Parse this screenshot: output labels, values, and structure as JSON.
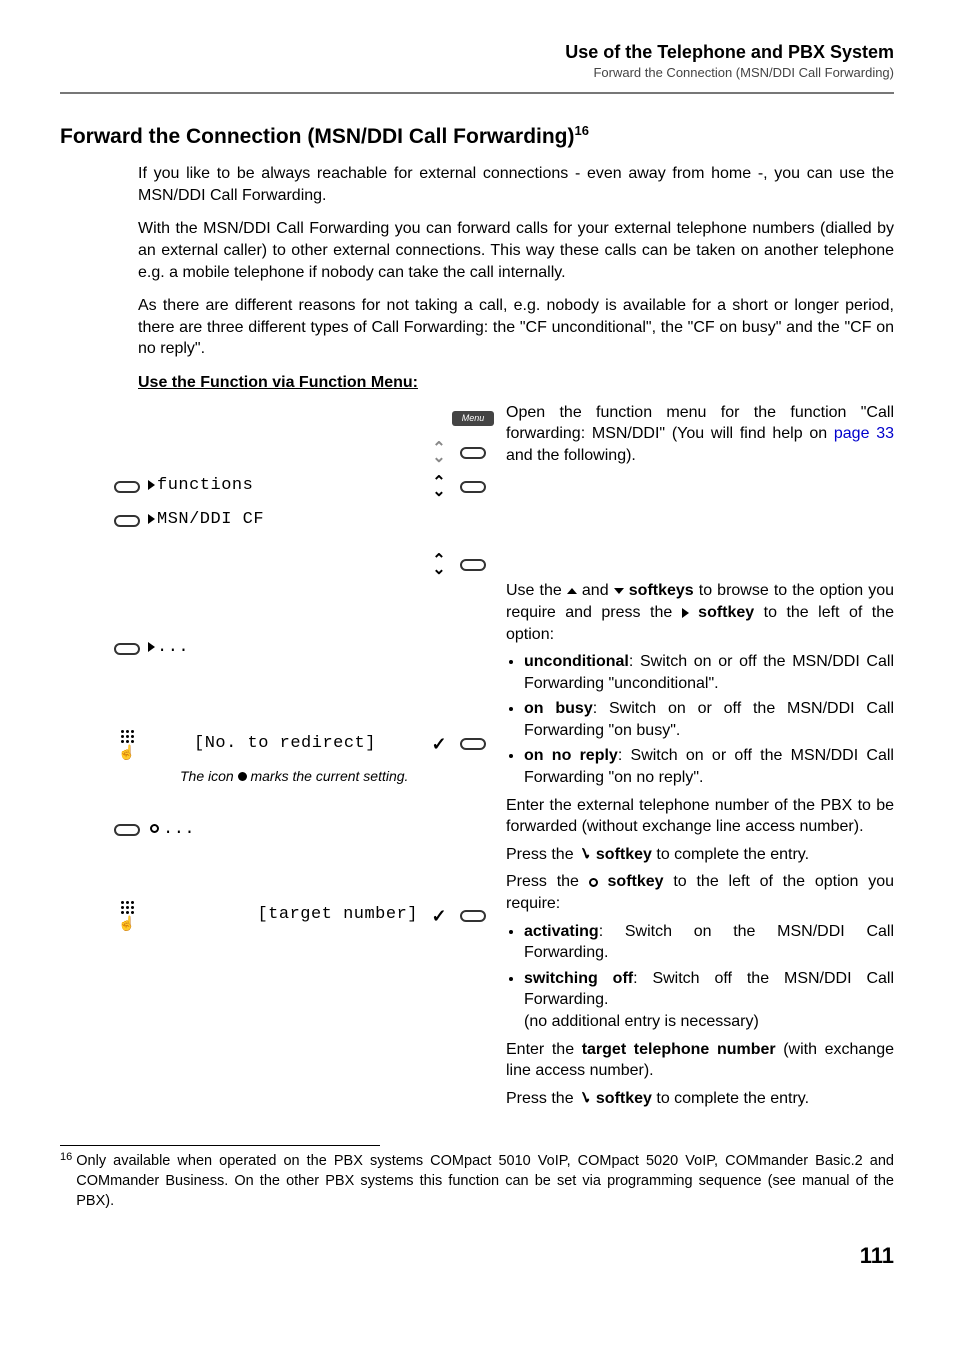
{
  "header": {
    "title": "Use of the Telephone and PBX System",
    "subtitle": "Forward the Connection (MSN/DDI Call Forwarding)"
  },
  "section": {
    "title": "Forward the Connection (MSN/DDI Call Forwarding)",
    "footnote_ref": "16",
    "para1": "If you like to be always reachable for external connections - even away from home -, you can use the MSN/DDI Call Forwarding.",
    "para2": "With the MSN/DDI Call Forwarding you can forward calls for your external telephone numbers (dialled by an external caller) to other external connections. This way these calls can be taken on another telephone e.g. a mobile telephone if nobody can take the call internally.",
    "para3": "As there are different reasons for not taking a call, e.g. nobody is available for a short or longer period, there are three different types of Call Forwarding: the \"CF unconditional\", the \"CF on busy\" and the \"CF on no reply\".",
    "subheading": "Use the Function via Function Menu:"
  },
  "left": {
    "menu_badge": "Menu",
    "row_functions": "functions",
    "row_msnddi": "MSN/DDI CF",
    "row_dots": "...",
    "row_no_redirect": "[No. to redirect]",
    "row_circle_dots": "...",
    "row_target": "[target number]",
    "note_pre": "The icon ",
    "note_post": " marks the current setting."
  },
  "right": {
    "open_p1": "Open the function menu for the function \"Call forwarding: MSN/DDI\" (You will find help on ",
    "open_link": "page 33",
    "open_p2": " and the following).",
    "browse_p1": "Use the ",
    "browse_p2": " and ",
    "browse_p3_pre": " ",
    "softkeys": "softkeys",
    "browse_p3": " to browse to the option you require and press the ",
    "softkey": "softkey",
    "browse_p4": " to the left of the option:",
    "li_uncond_b": "unconditional",
    "li_uncond_t": ": Switch on or off the MSN/DDI Call Forwarding \"unconditional\".",
    "li_busy_b": "on busy",
    "li_busy_t": ": Switch on or off the MSN/DDI Call Forwarding \"on busy\".",
    "li_noreply_b": "on no reply",
    "li_noreply_t": ": Switch on or off the MSN/DDI Call Forwarding \"on no reply\".",
    "enter_ext": "Enter the external telephone number of the PBX to be forwarded (without exchange line access number).",
    "press_check_pre": "Press the ",
    "press_check_post": " to complete the entry.",
    "press_hollow_pre": "Press the ",
    "press_hollow_post": " to the left of the option you require:",
    "li_act_b": "activating",
    "li_act_t": ": Switch on the MSN/DDI Call Forwarding.",
    "li_sw_b": "switching off",
    "li_sw_t": ": Switch off the MSN/DDI Call Forwarding.",
    "li_sw_extra": "(no additional entry is necessary)",
    "enter_target_pre": "Enter the ",
    "enter_target_b": "target telephone number",
    "enter_target_post": " (with exchange line access number).",
    "press_check2_pre": "Press the ",
    "press_check2_post": " to complete the entry."
  },
  "footnote": {
    "num": "16",
    "text": "Only available when operated on the PBX systems COMpact 5010 VoIP, COMpact 5020 VoIP, COMmander Basic.2 and COMmander Business. On the other PBX systems this function can be set via programming sequence (see manual of the PBX)."
  },
  "page_number": "111"
}
